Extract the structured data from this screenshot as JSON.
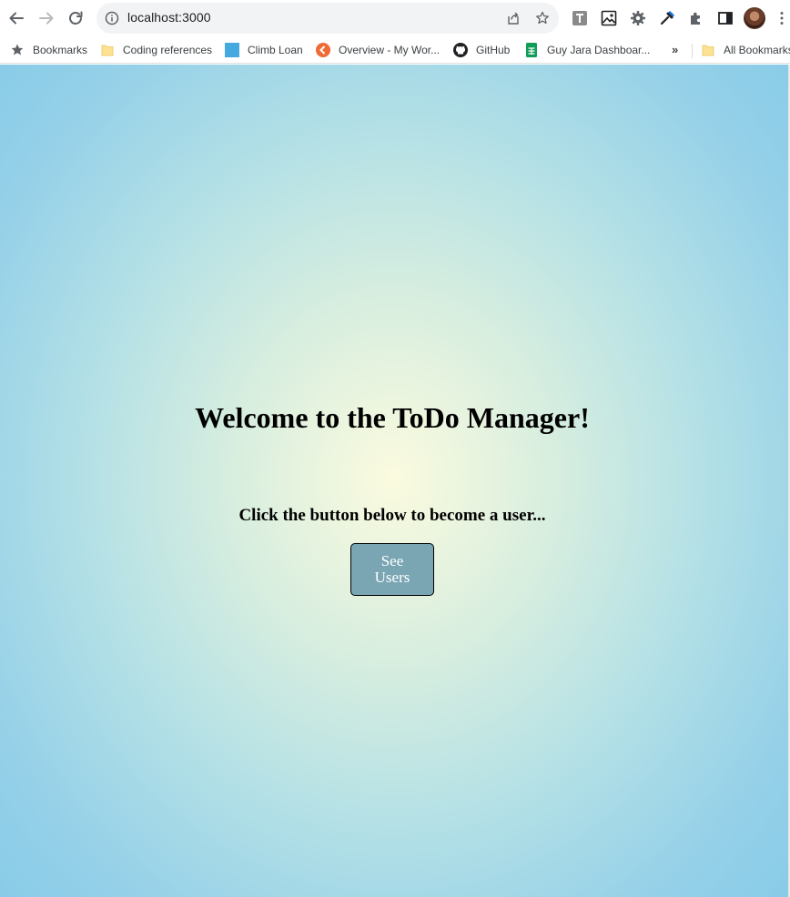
{
  "browser": {
    "url": "localhost:3000",
    "nav": {
      "back": "arrow-left-icon",
      "forward": "arrow-right-icon",
      "reload": "reload-icon"
    },
    "extensions": [
      "text-extension-icon",
      "image-extension-icon",
      "gear-extension-icon",
      "eyedropper-icon",
      "puzzle-extensions-icon",
      "side-panel-icon"
    ]
  },
  "bookmarks": {
    "items": [
      {
        "label": "Bookmarks",
        "icon": "star-icon"
      },
      {
        "label": "Coding references",
        "icon": "folder-icon"
      },
      {
        "label": "Climb Loan",
        "icon": "square-icon"
      },
      {
        "label": "Overview - My Wor...",
        "icon": "overview-icon"
      },
      {
        "label": "GitHub",
        "icon": "github-icon"
      },
      {
        "label": "Guy Jara Dashboar...",
        "icon": "sheets-icon"
      }
    ],
    "overflow": "»",
    "all_bookmarks": "All Bookmarks"
  },
  "page": {
    "heading": "Welcome to the ToDo Manager!",
    "subheading": "Click the button below to become a user...",
    "button_label": "See Users"
  },
  "colors": {
    "button_bg": "#7aa6b4",
    "gradient_center": "#fbfbdf",
    "gradient_edge": "#86cbe8"
  }
}
